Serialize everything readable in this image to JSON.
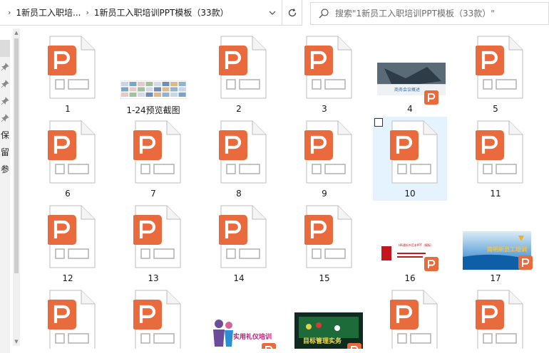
{
  "address_bar": {
    "crumbs": [
      "1新员工入职培...",
      "1新员工入职培训PPT模板（33款）"
    ],
    "separator": "›"
  },
  "search": {
    "placeholder": "搜索\"1新员工入职培训PPT模板（33款）\""
  },
  "left_pane": {
    "labels": [
      "保",
      "留",
      "参"
    ]
  },
  "files": [
    {
      "name": "1",
      "kind": "ppt"
    },
    {
      "name": "1-24预览截图",
      "kind": "preview-strip"
    },
    {
      "name": "2",
      "kind": "ppt"
    },
    {
      "name": "3",
      "kind": "ppt"
    },
    {
      "name": "4",
      "kind": "thumb-meeting",
      "thumb_text": "商务会议概述"
    },
    {
      "name": "5",
      "kind": "ppt"
    },
    {
      "name": "6",
      "kind": "ppt"
    },
    {
      "name": "7",
      "kind": "ppt"
    },
    {
      "name": "8",
      "kind": "ppt"
    },
    {
      "name": "9",
      "kind": "ppt"
    },
    {
      "name": "10",
      "kind": "ppt",
      "selected": true
    },
    {
      "name": "11",
      "kind": "ppt"
    },
    {
      "name": "12",
      "kind": "ppt"
    },
    {
      "name": "13",
      "kind": "ppt"
    },
    {
      "name": "14",
      "kind": "ppt"
    },
    {
      "name": "15",
      "kind": "ppt"
    },
    {
      "name": "16",
      "kind": "thumb-red",
      "thumb_text": "HR通知书范本PPT（模板）"
    },
    {
      "name": "17",
      "kind": "thumb-blue",
      "thumb_text": "简明新员工培训"
    },
    {
      "name": "",
      "kind": "ppt"
    },
    {
      "name": "",
      "kind": "ppt"
    },
    {
      "name": "",
      "kind": "thumb-etiquette",
      "thumb_text": "实用礼仪培训"
    },
    {
      "name": "",
      "kind": "thumb-green",
      "thumb_text": "目标管理实务"
    },
    {
      "name": "",
      "kind": "ppt"
    },
    {
      "name": "",
      "kind": "ppt"
    }
  ],
  "colors": {
    "ppt_badge": "#e96a3d",
    "selection": "#e5f3ff",
    "border": "#d9d9d9"
  },
  "icons": {
    "file": "powerpoint-file-icon",
    "refresh": "refresh-icon",
    "search": "search-icon",
    "pin": "pin-icon"
  }
}
